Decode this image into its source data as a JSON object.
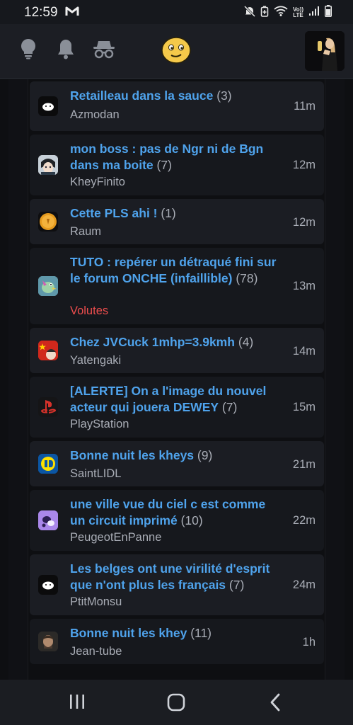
{
  "status_bar": {
    "time": "12:59",
    "vol": "Vo))",
    "lte": "LTE"
  },
  "header": {
    "icons": [
      "lightbulb-icon",
      "bell-icon",
      "incognito-icon",
      "smiley-logo-icon"
    ],
    "profile_avatar": "user-avatar"
  },
  "topics": [
    {
      "title": "Retailleau dans la sauce",
      "count": "(3)",
      "author": "Azmodan",
      "time": "11m",
      "author_color": "#a9adb6",
      "avatar": "cloud-avatar"
    },
    {
      "title": "mon boss : pas de Ngr ni de Bgn dans ma boite",
      "count": "(7)",
      "author": "KheyFinito",
      "time": "12m",
      "author_color": "#a9adb6",
      "avatar": "anime-avatar"
    },
    {
      "title": "Cette PLS ahi !",
      "count": "(1)",
      "author": "Raum",
      "time": "12m",
      "author_color": "#a9adb6",
      "avatar": "coin-avatar"
    },
    {
      "title": "TUTO : repérer un détraqué fini sur le forum ONCHE (infaillible)",
      "count": "(78)",
      "author": "Volutes",
      "time": "13m",
      "author_color": "#ec4d4d",
      "avatar": "bird-avatar"
    },
    {
      "title": "Chez JVCuck 1mhp=3.9kmh",
      "count": "(4)",
      "author": "Yatengaki",
      "time": "14m",
      "author_color": "#a9adb6",
      "avatar": "flag-avatar"
    },
    {
      "title": "[ALERTE] On a l'image du nouvel acteur qui jouera DEWEY",
      "count": "(7)",
      "author": "PlayStation",
      "time": "15m",
      "author_color": "#a9adb6",
      "avatar": "playstation-avatar"
    },
    {
      "title": "Bonne nuit les kheys",
      "count": "(9)",
      "author": "SaintLIDL",
      "time": "21m",
      "author_color": "#a9adb6",
      "avatar": "lidl-avatar"
    },
    {
      "title": "une ville vue du ciel c est comme un circuit imprimé",
      "count": "(10)",
      "author": "PeugeotEnPanne",
      "time": "22m",
      "author_color": "#a9adb6",
      "avatar": "purple-avatar"
    },
    {
      "title": "Les belges ont une virilité d'esprit que n'ont plus les français",
      "count": "(7)",
      "author": "PtitMonsu",
      "time": "24m",
      "author_color": "#a9adb6",
      "avatar": "cloud-avatar"
    },
    {
      "title": "Bonne nuit les khey",
      "count": "(11)",
      "author": "Jean-tube",
      "time": "1h",
      "author_color": "#a9adb6",
      "avatar": "portrait-avatar"
    }
  ],
  "nav_bar": {
    "icons": [
      "recent-apps-icon",
      "home-icon",
      "back-icon"
    ]
  },
  "colors": {
    "link": "#4fa3ec",
    "muted": "#a9adb6",
    "accent_red": "#ec4d4d",
    "background": "#0e0f12"
  }
}
